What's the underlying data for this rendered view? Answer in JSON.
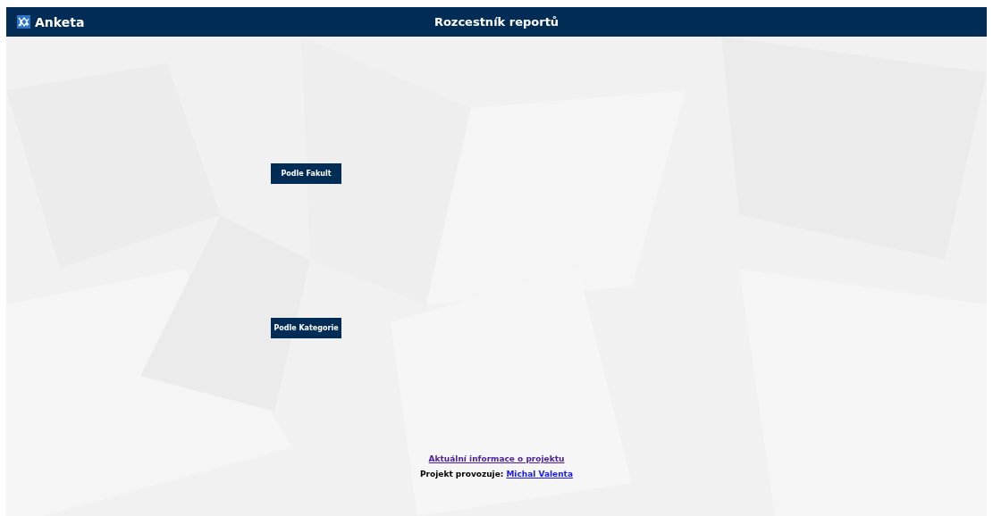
{
  "header": {
    "brand": "Anketa",
    "title": "Rozcestník reportů"
  },
  "buttons": [
    {
      "label": "Podle Fakult"
    },
    {
      "label": "Podle Kategorie"
    }
  ],
  "footer": {
    "info_link": "Aktuální informace o projektu",
    "operator_label": "Projekt provozuje:",
    "operator_link": "Michal Valenta"
  }
}
